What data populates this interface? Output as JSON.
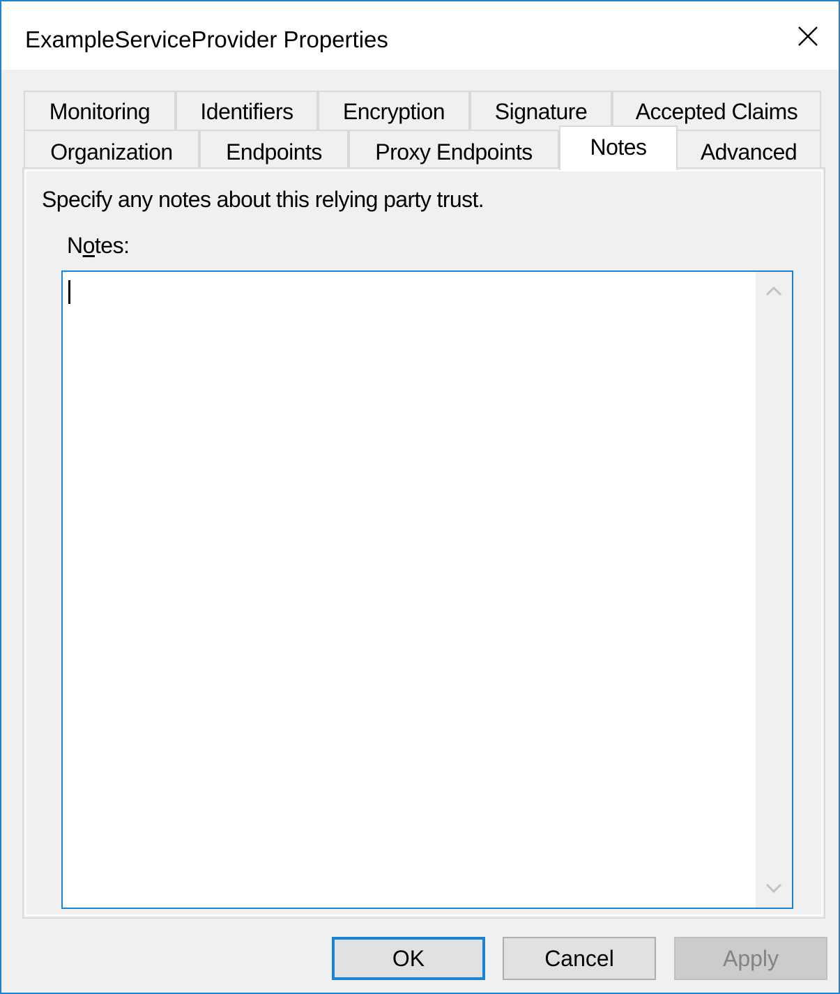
{
  "window": {
    "title": "ExampleServiceProvider Properties",
    "accent_color": "#1883d7",
    "close_icon": "close-icon"
  },
  "tabs": {
    "row1": [
      {
        "label": "Monitoring"
      },
      {
        "label": "Identifiers"
      },
      {
        "label": "Encryption"
      },
      {
        "label": "Signature"
      },
      {
        "label": "Accepted Claims"
      }
    ],
    "row2": [
      {
        "label": "Organization"
      },
      {
        "label": "Endpoints"
      },
      {
        "label": "Proxy Endpoints"
      },
      {
        "label": "Notes",
        "selected": true
      },
      {
        "label": "Advanced"
      }
    ]
  },
  "panel": {
    "description": "Specify any notes about this relying party trust.",
    "notes_label": "Notes:",
    "notes_mnemonic": "o",
    "notes_value": ""
  },
  "buttons": {
    "ok": "OK",
    "cancel": "Cancel",
    "apply": "Apply",
    "apply_disabled": true
  }
}
